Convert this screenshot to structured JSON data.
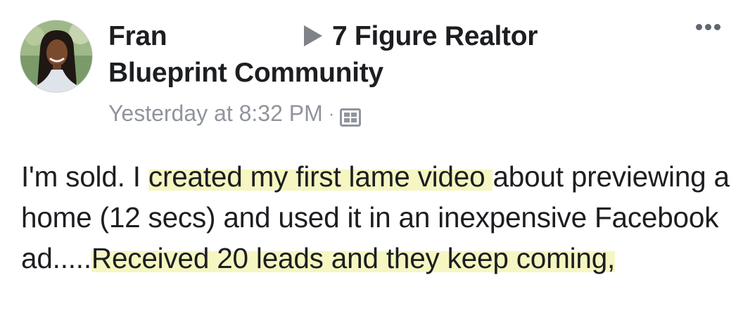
{
  "post": {
    "author": "Fran",
    "group": "7 Figure Realtor Blueprint Community",
    "group_line1": "7 Figure Realtor",
    "group_line2": "Blueprint Community",
    "timestamp": "Yesterday at 8:32 PM",
    "separator": "·",
    "privacy_icon": "photo-album-icon",
    "more_icon": "more-options-icon",
    "text_part1": "I'm sold.  I ",
    "text_highlight1": "created my first lame video ",
    "text_part2": "about previewing a home (12 secs) and used it in an inexpensive Facebook ad.....",
    "text_highlight2": "Received 20 leads and they keep coming,",
    "highlight_color": "#f6f6c2"
  }
}
